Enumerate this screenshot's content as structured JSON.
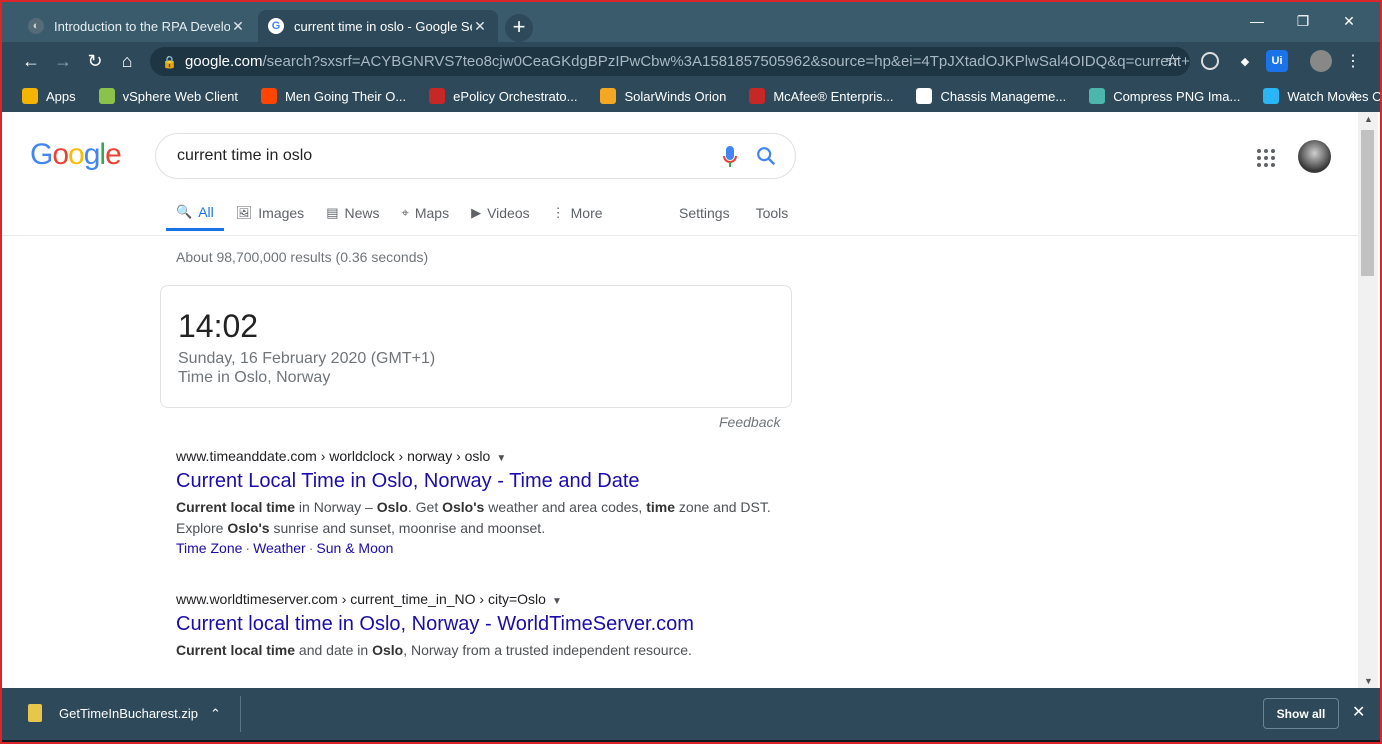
{
  "tabs": [
    {
      "title": "Introduction to the RPA Develope",
      "active": false
    },
    {
      "title": "current time in oslo - Google Sea",
      "active": true
    }
  ],
  "window_controls": {
    "minimize": "—",
    "maximize": "❐",
    "close": "✕"
  },
  "address": {
    "host": "google.com",
    "path": "/search?sxsrf=ACYBGNRVS7teo8cjw0CeaGKdgBPzIPwCbw%3A1581857505962&source=hp&ei=4TpJXtadOJKPlwSal4OIDQ&q=current+time+i..."
  },
  "extensions": [
    "Ui"
  ],
  "bookmarks": [
    {
      "label": "Apps",
      "color": "#f4b400"
    },
    {
      "label": "vSphere Web Client",
      "color": "#8bc34a"
    },
    {
      "label": "Men Going Their O...",
      "color": "#ff4500"
    },
    {
      "label": "ePolicy Orchestrato...",
      "color": "#c62828"
    },
    {
      "label": "SolarWinds Orion",
      "color": "#f5a623"
    },
    {
      "label": "McAfee® Enterpris...",
      "color": "#c62828"
    },
    {
      "label": "Chassis Manageme...",
      "color": "#ffffff"
    },
    {
      "label": "Compress PNG Ima...",
      "color": "#4db6ac"
    },
    {
      "label": "Watch Movies Onli...",
      "color": "#29b6f6"
    }
  ],
  "bookmarks_more": "»",
  "google": {
    "logo": [
      {
        "ch": "G",
        "color": "#4285f4"
      },
      {
        "ch": "o",
        "color": "#ea4335"
      },
      {
        "ch": "o",
        "color": "#fbbc05"
      },
      {
        "ch": "g",
        "color": "#4285f4"
      },
      {
        "ch": "l",
        "color": "#34a853"
      },
      {
        "ch": "e",
        "color": "#ea4335"
      }
    ],
    "query": "current time in oslo",
    "search_tabs": [
      {
        "label": "All",
        "icon": "🔍",
        "active": true
      },
      {
        "label": "Images",
        "icon": "🖼",
        "active": false
      },
      {
        "label": "News",
        "icon": "▤",
        "active": false
      },
      {
        "label": "Maps",
        "icon": "⌖",
        "active": false
      },
      {
        "label": "Videos",
        "icon": "▶",
        "active": false
      },
      {
        "label": "More",
        "icon": "⋮",
        "active": false
      }
    ],
    "settings_label": "Settings",
    "tools_label": "Tools",
    "stats": "About 98,700,000 results (0.36 seconds)",
    "time_card": {
      "time": "14:02",
      "date": "Sunday, 16 February 2020 (GMT+1)",
      "location": "Time in Oslo, Norway"
    },
    "feedback": "Feedback",
    "results": [
      {
        "cite": "www.timeanddate.com › worldclock › norway › oslo",
        "title": "Current Local Time in Oslo, Norway - Time and Date",
        "snippet_html": "<b>Current local time</b> in Norway – <b>Oslo</b>. Get <b>Oslo's</b> weather and area codes, <b>time</b> zone and DST. Explore <b>Oslo's</b> sunrise and sunset, moonrise and moonset.",
        "sitelinks": [
          "Time Zone",
          "Weather",
          "Sun & Moon"
        ]
      },
      {
        "cite": "www.worldtimeserver.com › current_time_in_NO › city=Oslo",
        "title": "Current local time in Oslo, Norway - WorldTimeServer.com",
        "snippet_html": "<b>Current local time</b> and date in <b>Oslo</b>, Norway from a trusted independent resource.",
        "sitelinks": []
      }
    ]
  },
  "downloads": {
    "file": "GetTimeInBucharest.zip",
    "show_all": "Show all"
  }
}
